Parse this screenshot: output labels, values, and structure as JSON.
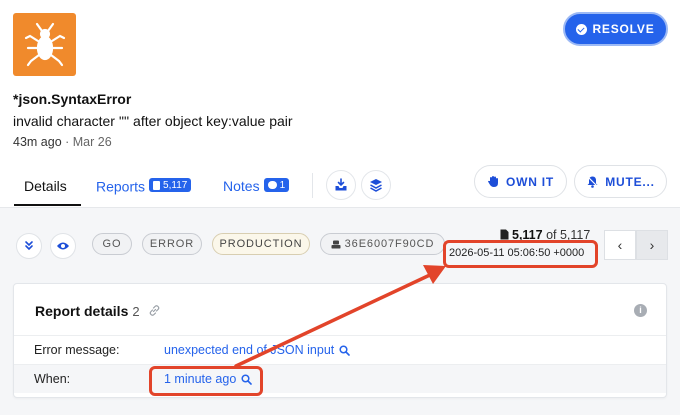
{
  "header": {
    "logo_icon": "bug-icon",
    "resolve_label": "RESOLVE",
    "error_title": "*json.SyntaxError",
    "error_message": "invalid character '\"' after object key:value pair",
    "time_ago": "43m ago",
    "time_sep": " · ",
    "time_date": "Mar 26"
  },
  "tabs": {
    "details": "Details",
    "reports": "Reports",
    "reports_count": "5,117",
    "notes": "Notes",
    "notes_count": "1"
  },
  "actions": {
    "own_label": "OWN IT",
    "mute_label": "MUTE..."
  },
  "tags": {
    "go": "GO",
    "error": "ERROR",
    "production": "PRODUCTION",
    "commit": "36E6007F90CD"
  },
  "pagination": {
    "current": "5,117",
    "of": " of ",
    "total": "5,117",
    "timestamp": "2026-05-11 05:06:50 +0000",
    "prev": "‹",
    "next": "›"
  },
  "report": {
    "title": "Report details",
    "count": "2",
    "rows": [
      {
        "label": "Error message:",
        "value": "unexpected end of JSON input"
      },
      {
        "label": "When:",
        "value": "1 minute ago"
      }
    ]
  },
  "colors": {
    "accent": "#2563eb",
    "logo": "#f08a2c",
    "annotation": "#e2442a"
  }
}
